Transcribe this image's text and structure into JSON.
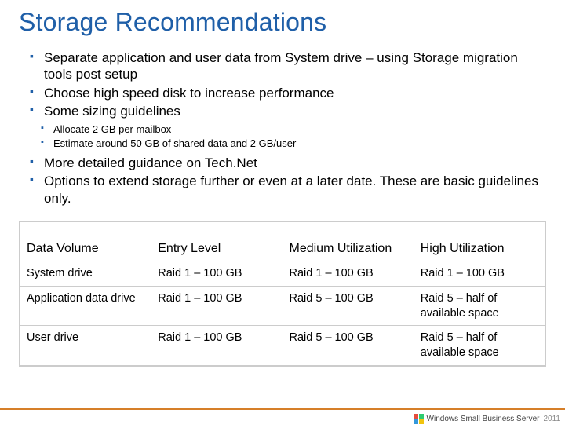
{
  "title": "Storage Recommendations",
  "bullets": {
    "b0": "Separate application and user data from System drive – using Storage migration tools post setup",
    "b1": "Choose high speed disk to increase performance",
    "b2": "Some sizing guidelines",
    "b2s0": "Allocate 2 GB per mailbox",
    "b2s1": "Estimate around 50 GB of shared data and 2 GB/user",
    "b3": "More detailed guidance on Tech.Net",
    "b4": "Options to extend storage further or even at a later date. These are basic guidelines only."
  },
  "table": {
    "headers": {
      "h0": "Data Volume",
      "h1": "Entry Level",
      "h2": "Medium Utilization",
      "h3": "High Utilization"
    },
    "rows": [
      {
        "c0": "System drive",
        "c1": "Raid 1 – 100 GB",
        "c2": "Raid 1 – 100 GB",
        "c3": "Raid 1 – 100 GB"
      },
      {
        "c0": "Application data drive",
        "c1": "Raid 1 – 100 GB",
        "c2": "Raid 5 – 100 GB",
        "c3": "Raid 5 – half of available space"
      },
      {
        "c0": "User drive",
        "c1": "Raid 1 – 100 GB",
        "c2": "Raid 5 – 100 GB",
        "c3": "Raid 5 – half of available space"
      }
    ]
  },
  "footer": {
    "brand": "Windows Small Business Server",
    "year": "2011"
  }
}
